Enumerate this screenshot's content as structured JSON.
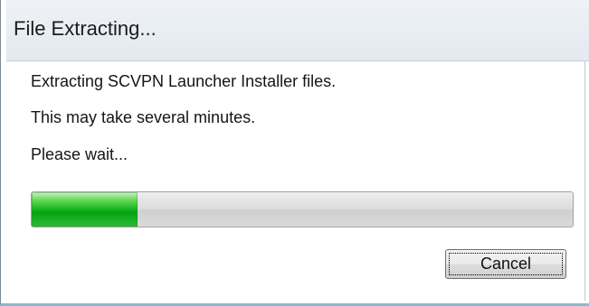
{
  "window": {
    "title": "File Extracting..."
  },
  "messages": {
    "line1": "Extracting SCVPN Launcher Installer files.",
    "line2": "This may take several minutes.",
    "line3": "Please wait..."
  },
  "progress": {
    "fraction": 0.196,
    "fill_color": "#15b71d"
  },
  "buttons": {
    "cancel_label": "Cancel"
  }
}
